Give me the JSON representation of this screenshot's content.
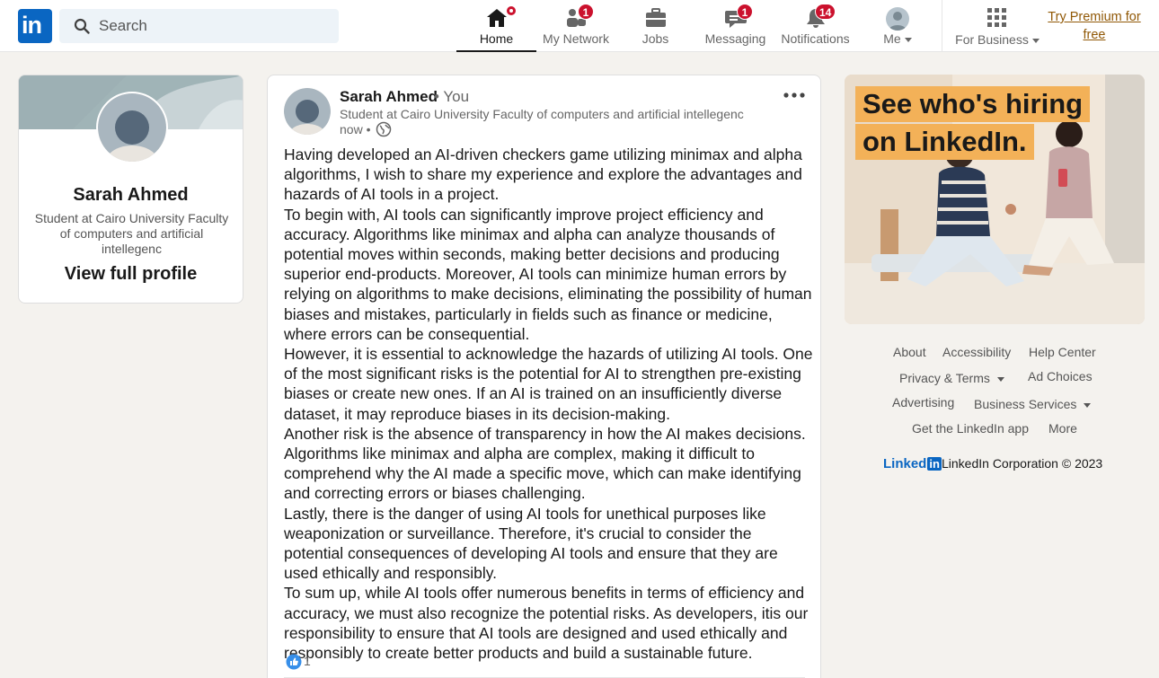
{
  "header": {
    "logo_text": "in",
    "search": {
      "placeholder": "Search"
    },
    "nav": [
      {
        "label": "Home",
        "icon": "home-icon",
        "badge": ""
      },
      {
        "label": "My Network",
        "icon": "network-icon",
        "badge": "1"
      },
      {
        "label": "Jobs",
        "icon": "briefcase-icon",
        "badge": ""
      },
      {
        "label": "Messaging",
        "icon": "message-icon",
        "badge": "1"
      },
      {
        "label": "Notifications",
        "icon": "bell-icon",
        "badge": "14"
      },
      {
        "label": "Me",
        "icon": "avatar",
        "badge": ""
      },
      {
        "label": "For Business",
        "icon": "grid-icon",
        "badge": ""
      }
    ],
    "premium_line1": "Try Premium for",
    "premium_line2": "free"
  },
  "profile": {
    "name": "Sarah Ahmed",
    "headline": "Student at Cairo University Faculty of computers and artificial intellegenc",
    "view_profile": "View full profile"
  },
  "post": {
    "author": "Sarah Ahmed",
    "degree": "• You",
    "headline": "Student at Cairo University Faculty of computers and artificial intellegenc",
    "time": "now •",
    "body": [
      "Having developed an AI-driven checkers game utilizing minimax and alpha algorithms, I wish to share my experience and explore the advantages and hazards of AI tools in a project.",
      "To begin with, AI tools can significantly improve project efficiency and accuracy. Algorithms like minimax and alpha can analyze thousands of potential moves within seconds, making better decisions and producing superior end-products. Moreover, AI tools can minimize human errors by relying on algorithms to make decisions, eliminating the possibility of human biases and mistakes, particularly in fields such as finance or medicine, where errors can be consequential.",
      "However, it is essential to acknowledge the hazards of utilizing AI tools. One of the most significant risks is the potential for AI to strengthen pre-existing biases or create new ones. If an AI is trained on an insufficiently diverse dataset, it may reproduce biases in its decision-making.",
      "Another risk is the absence of transparency in how the AI makes decisions. Algorithms like minimax and alpha are complex, making it difficult to comprehend why the AI made a specific move, which can make identifying and correcting errors or biases challenging.",
      "Lastly, there is the danger of using AI tools for unethical purposes like weaponization or surveillance. Therefore, it's crucial to consider the potential consequences of developing AI tools and ensure that they are used ethically and responsibly.",
      "To sum up, while AI tools offer numerous benefits in terms of efficiency and accuracy, we must also recognize the potential risks. As developers, itis our responsibility to ensure that AI tools are designed and used ethically and responsibly to create better products and build a sustainable future."
    ],
    "reaction_count": "1"
  },
  "ad": {
    "line1": "See who's hiring",
    "line2": "on LinkedIn."
  },
  "footer": {
    "about": "About",
    "accessibility": "Accessibility",
    "help_center": "Help Center",
    "privacy_terms": "Privacy & Terms",
    "ad_choices": "Ad Choices",
    "advertising": "Advertising",
    "business_services": "Business Services",
    "get_app": "Get the LinkedIn app",
    "more": "More",
    "brand_linked": "Linked",
    "brand_in": "in",
    "copyright": "LinkedIn Corporation © 2023"
  },
  "colors": {
    "brand": "#0a66c2",
    "badge": "#cb112d",
    "premium": "#915907",
    "page_bg": "#f4f2ee"
  }
}
